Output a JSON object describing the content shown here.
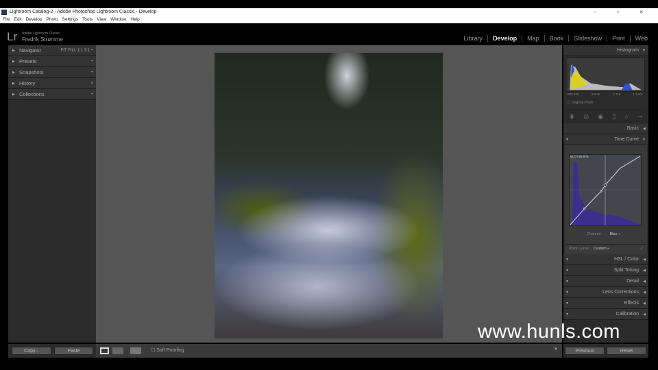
{
  "window": {
    "title": "Lightroom Catalog-2 - Adobe Photoshop Lightroom Classic - Develop",
    "controls": "– ▫ ×"
  },
  "menu": [
    "File",
    "Edit",
    "Develop",
    "Photo",
    "Settings",
    "Tools",
    "View",
    "Window",
    "Help"
  ],
  "identity": {
    "logo": "Lr",
    "product": "Adobe Lightroom Classic",
    "user": "Fredrik Strømme"
  },
  "modules": [
    "Library",
    "Develop",
    "Map",
    "Book",
    "Slideshow",
    "Print",
    "Web"
  ],
  "left_panels": [
    {
      "label": "Navigator",
      "right": "FIT  FILL  1:1  3:1 ÷"
    },
    {
      "label": "Presets",
      "right": "+"
    },
    {
      "label": "Snapshots",
      "right": "+"
    },
    {
      "label": "History",
      "right": "×"
    },
    {
      "label": "Collections",
      "right": "+"
    }
  ],
  "histogram": {
    "title": "Histogram",
    "meta": [
      "ISO 400",
      "24mm",
      "f / 5.6",
      "1.3 sec"
    ],
    "original_photo": "Original Photo"
  },
  "basic": "Basic",
  "tone_curve": {
    "title": "Tone Curve",
    "readout": "51.0 / 56.9 %",
    "channel_label": "Channel :",
    "channel_value": "Blue ÷",
    "point_curve_label": "Point Curve :",
    "point_curve_value": "Custom ÷"
  },
  "right_panels": [
    "HSL / Color",
    "Split Toning",
    "Detail",
    "Lens Corrections",
    "Effects",
    "Calibration"
  ],
  "bottom": {
    "copy": "Copy...",
    "paste": "Paste",
    "soft_proofing": "Soft Proofing",
    "previous": "Previous",
    "reset": "Reset"
  },
  "watermark": "www.hunls.com"
}
